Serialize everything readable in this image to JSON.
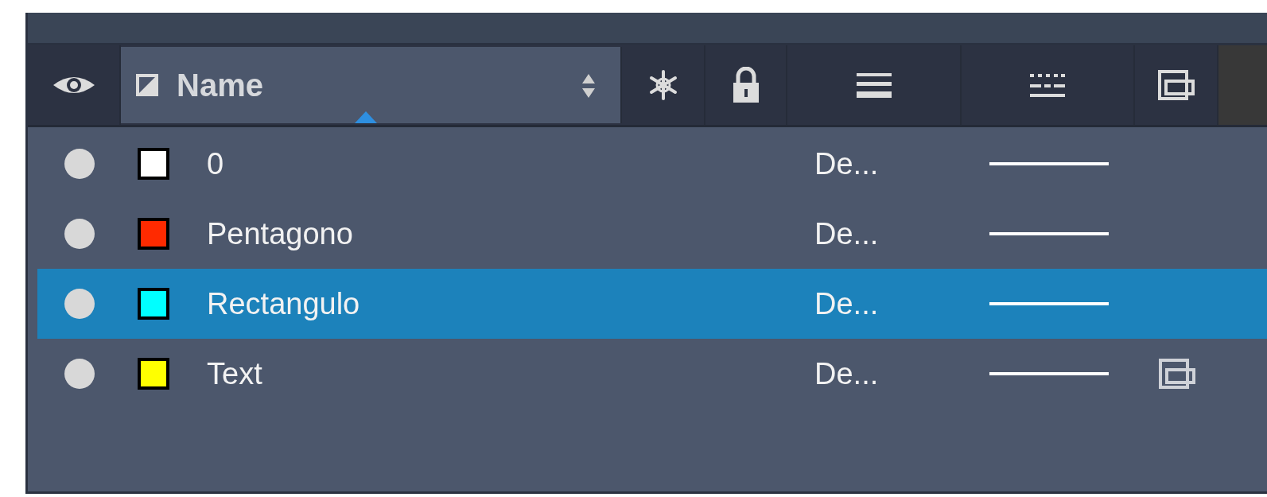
{
  "header": {
    "name_label": "Name"
  },
  "layers": [
    {
      "name": "0",
      "color": "#ffffff",
      "selected": false,
      "lineweight": "De...",
      "marked": false
    },
    {
      "name": "Pentagono",
      "color": "#ff2a00",
      "selected": false,
      "lineweight": "De...",
      "marked": false
    },
    {
      "name": "Rectangulo",
      "color": "#00ffff",
      "selected": true,
      "lineweight": "De...",
      "marked": false
    },
    {
      "name": "Text",
      "color": "#ffff00",
      "selected": false,
      "lineweight": "De...",
      "marked": true
    }
  ]
}
